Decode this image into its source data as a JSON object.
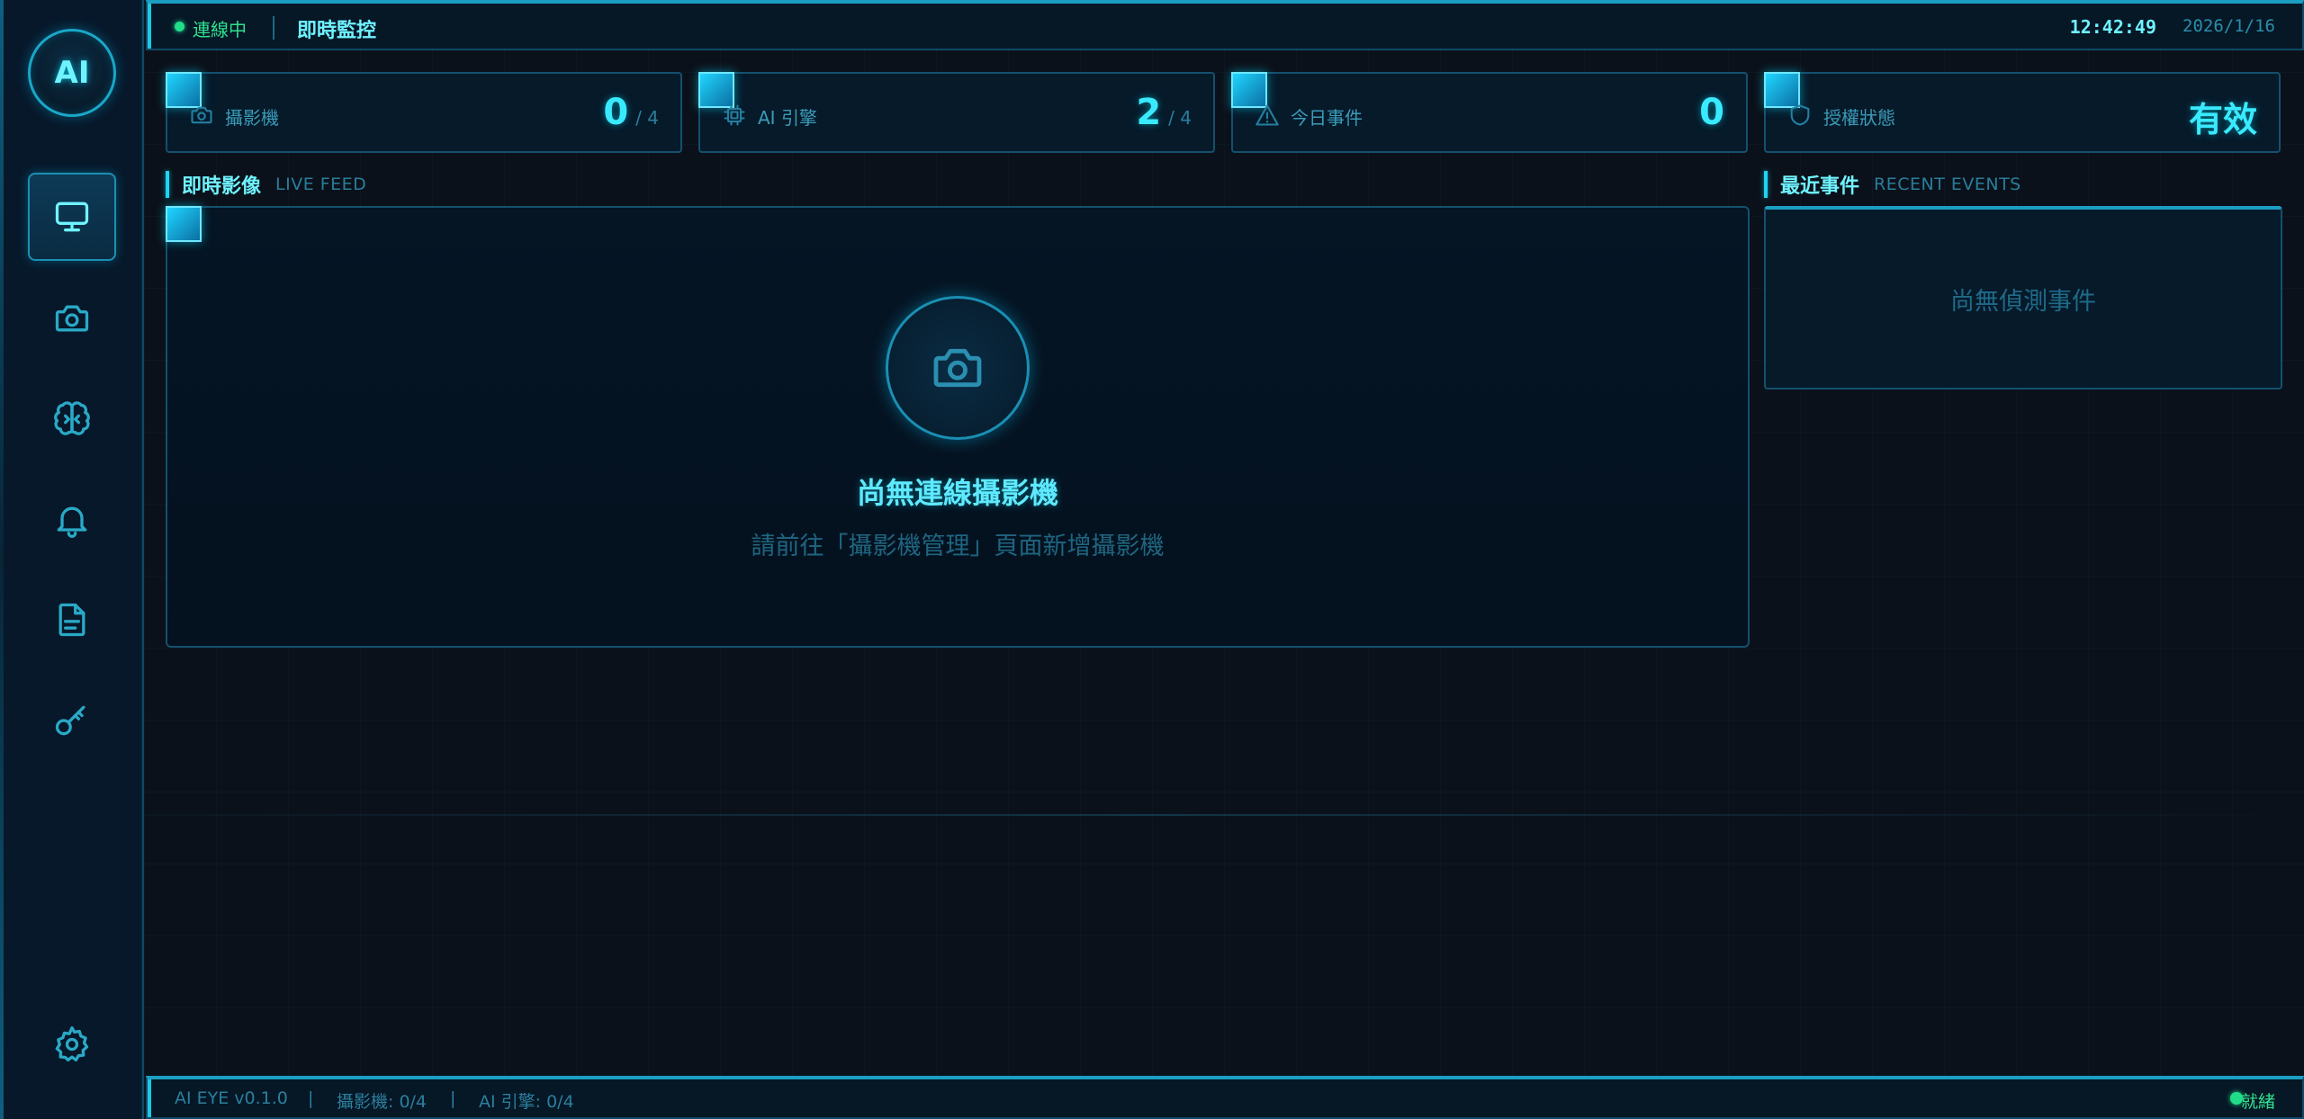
{
  "app": {
    "logo_text": "AI"
  },
  "topbar": {
    "connection_status": "連線中",
    "page_title": "即時監控",
    "time": "12:42:49",
    "date": "2026/1/16"
  },
  "sidebar": {
    "items": [
      {
        "name": "monitor",
        "icon": "monitor-icon",
        "active": true
      },
      {
        "name": "camera",
        "icon": "camera-icon",
        "active": false
      },
      {
        "name": "ai-engine",
        "icon": "brain-icon",
        "active": false
      },
      {
        "name": "alerts",
        "icon": "bell-icon",
        "active": false
      },
      {
        "name": "logs",
        "icon": "document-icon",
        "active": false
      },
      {
        "name": "license",
        "icon": "key-icon",
        "active": false
      },
      {
        "name": "settings",
        "icon": "gear-icon",
        "active": false
      }
    ]
  },
  "stats": {
    "cameras": {
      "label": "攝影機",
      "value": "0",
      "total": "/ 4",
      "icon": "camera-icon"
    },
    "ai_engines": {
      "label": "AI 引擎",
      "value": "2",
      "total": "/ 4",
      "icon": "chip-icon"
    },
    "today_events": {
      "label": "今日事件",
      "value": "0",
      "icon": "warning-icon"
    },
    "license": {
      "label": "授權狀態",
      "value": "有效",
      "icon": "shield-icon"
    }
  },
  "live_feed": {
    "title_zh": "即時影像",
    "title_en": "LIVE FEED",
    "empty_title": "尚無連線攝影機",
    "empty_hint": "請前往「攝影機管理」頁面新增攝影機"
  },
  "recent_events": {
    "title_zh": "最近事件",
    "title_en": "RECENT EVENTS",
    "empty_text": "尚無偵測事件"
  },
  "footer": {
    "version": "AI EYE v0.1.0",
    "separator": "|",
    "cameras": "攝影機: 0/4",
    "ai_engines": "AI 引擎: 0/4",
    "ready": "就緒"
  },
  "colors": {
    "accent": "#39eaff",
    "status_ok": "#22dd88",
    "border": "#14506d",
    "background": "#0b111a"
  }
}
